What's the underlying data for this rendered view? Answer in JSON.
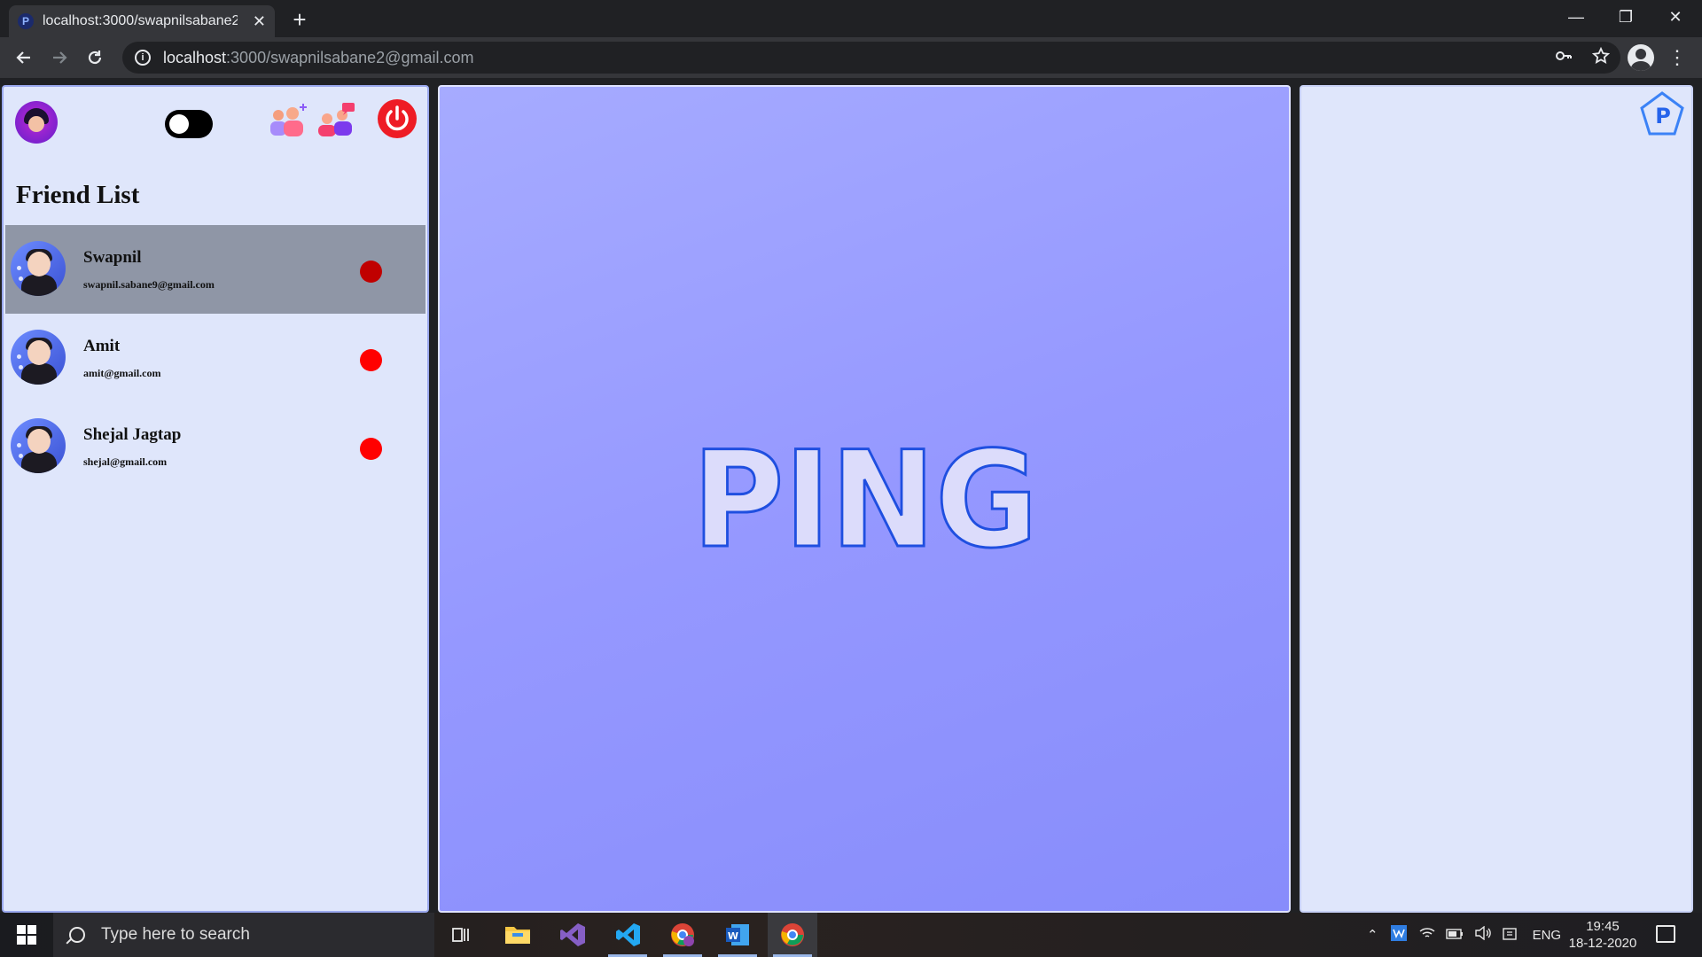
{
  "browser": {
    "tab_title": "localhost:3000/swapnilsabane2@",
    "tab_favicon": "P",
    "new_tab": "+",
    "url_host": "localhost",
    "url_path": ":3000/swapnilsabane2@gmail.com",
    "window_controls": {
      "minimize": "—",
      "restore": "❐",
      "close": "✕"
    }
  },
  "sidebar": {
    "title": "Friend List",
    "theme_toggle_on": false,
    "friends": [
      {
        "name": "Swapnil",
        "email": "swapnil.sabane9@gmail.com",
        "status_color": "#c00000",
        "selected": true
      },
      {
        "name": "Amit",
        "email": "amit@gmail.com",
        "status_color": "#ff0000",
        "selected": false
      },
      {
        "name": "Shejal Jagtap",
        "email": "shejal@gmail.com",
        "status_color": "#ff0000",
        "selected": false
      }
    ]
  },
  "main": {
    "logo_text": "PING"
  },
  "brand": {
    "logo_letter": "P"
  },
  "colors": {
    "accent": "#1f4fe0",
    "panel": "#dfe6fb",
    "center_start": "#a6abff",
    "center_end": "#878cfb",
    "power": "#ee1c25"
  },
  "taskbar": {
    "search_placeholder": "Type here to search",
    "language": "ENG",
    "time": "19:45",
    "date": "18-12-2020"
  }
}
